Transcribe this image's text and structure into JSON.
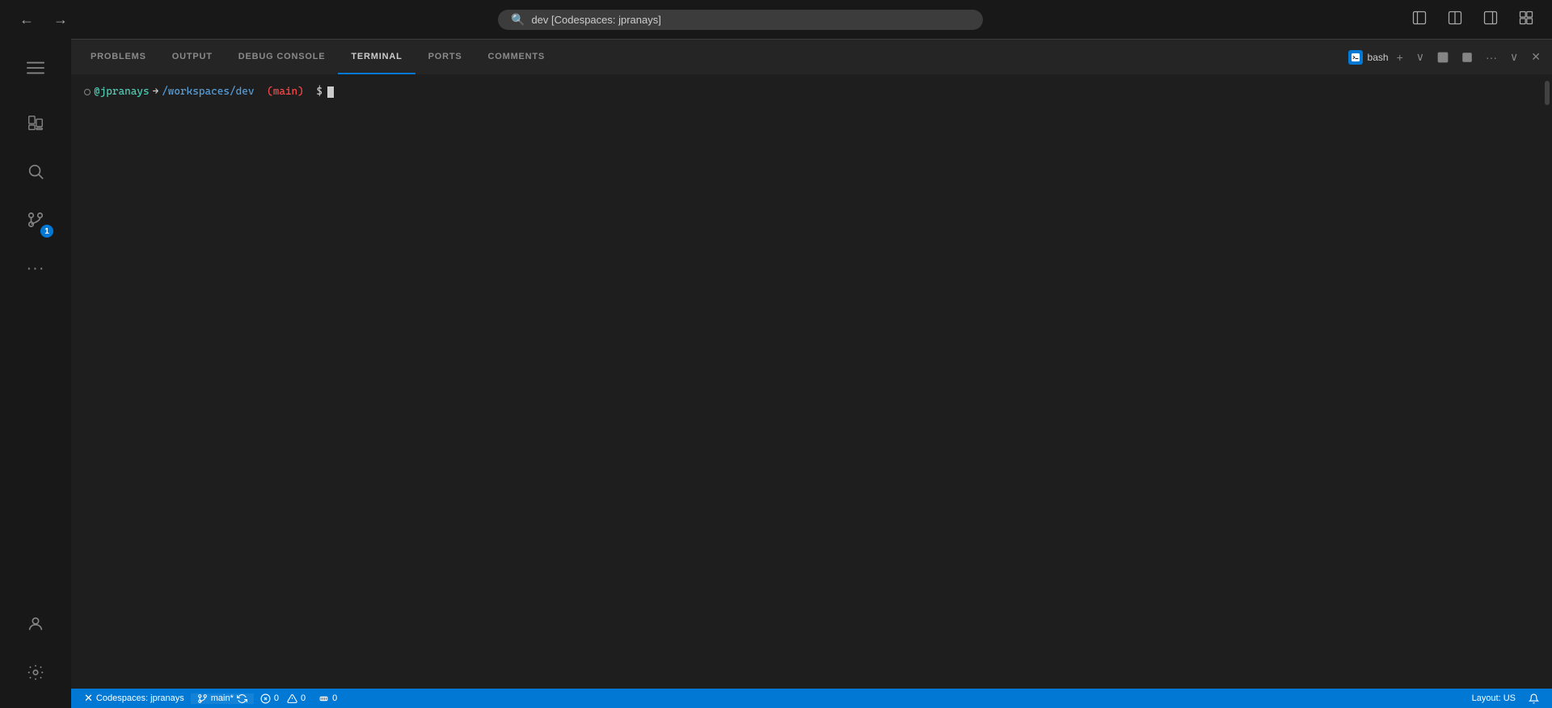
{
  "titlebar": {
    "search_placeholder": "dev [Codespaces: jpranays]",
    "search_value": "dev [Codespaces: jpranays]"
  },
  "activitybar": {
    "items": [
      {
        "id": "hamburger",
        "icon": "≡",
        "label": "hamburger-menu",
        "active": false
      },
      {
        "id": "explorer",
        "icon": "⧉",
        "label": "explorer",
        "active": false
      },
      {
        "id": "search",
        "icon": "🔍",
        "label": "search",
        "active": false
      },
      {
        "id": "source-control",
        "icon": "⑂",
        "label": "source-control",
        "badge": "1",
        "active": false
      },
      {
        "id": "extensions",
        "icon": "···",
        "label": "extensions",
        "active": false
      }
    ],
    "bottom_items": [
      {
        "id": "account",
        "icon": "👤",
        "label": "account",
        "active": false
      },
      {
        "id": "settings",
        "icon": "⚙",
        "label": "settings",
        "active": false
      }
    ]
  },
  "panel": {
    "tabs": [
      {
        "id": "problems",
        "label": "PROBLEMS",
        "active": false
      },
      {
        "id": "output",
        "label": "OUTPUT",
        "active": false
      },
      {
        "id": "debug-console",
        "label": "DEBUG CONSOLE",
        "active": false
      },
      {
        "id": "terminal",
        "label": "TERMINAL",
        "active": true
      },
      {
        "id": "ports",
        "label": "PORTS",
        "active": false
      },
      {
        "id": "comments",
        "label": "COMMENTS",
        "active": false
      }
    ],
    "toolbar": {
      "bash_label": "bash",
      "add_label": "+",
      "chevron_label": "∨",
      "split_label": "⊟",
      "trash_label": "🗑",
      "more_label": "···",
      "chevron_down_label": "∨",
      "close_label": "✕"
    }
  },
  "terminal": {
    "prompt_user": "@jpranays",
    "prompt_arrow": "→",
    "prompt_path": "/workspaces/dev",
    "prompt_branch": "(main)",
    "prompt_dollar": "$"
  },
  "statusbar": {
    "codespaces_label": "Codespaces: jpranays",
    "branch_label": "main*",
    "sync_label": "",
    "errors_count": "0",
    "warnings_count": "0",
    "ports_label": "0",
    "layout_label": "Layout: US",
    "bell_label": "🔔"
  }
}
